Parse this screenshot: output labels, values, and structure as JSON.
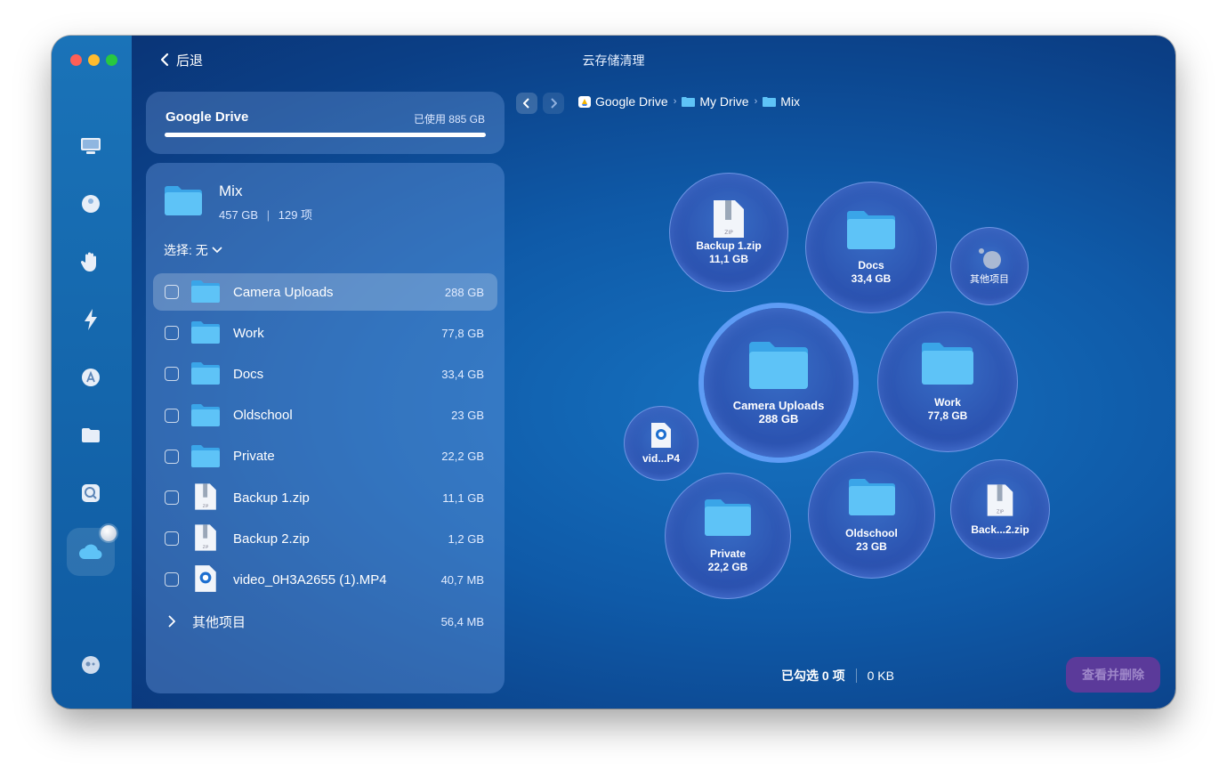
{
  "window": {
    "title": "云存储清理",
    "back_label": "后退"
  },
  "drive": {
    "name": "Google Drive",
    "used": "已使用 885 GB"
  },
  "folder": {
    "name": "Mix",
    "size": "457 GB",
    "count": "129 项",
    "separator": "|",
    "select_label": "选择: 无"
  },
  "items": [
    {
      "name": "Camera Uploads",
      "size": "288 GB",
      "type": "folder"
    },
    {
      "name": "Work",
      "size": "77,8 GB",
      "type": "folder"
    },
    {
      "name": "Docs",
      "size": "33,4 GB",
      "type": "folder"
    },
    {
      "name": "Oldschool",
      "size": "23 GB",
      "type": "folder"
    },
    {
      "name": "Private",
      "size": "22,2 GB",
      "type": "folder"
    },
    {
      "name": "Backup 1.zip",
      "size": "11,1 GB",
      "type": "zip"
    },
    {
      "name": "Backup 2.zip",
      "size": "1,2 GB",
      "type": "zip"
    },
    {
      "name": "video_0H3A2655 (1).MP4",
      "size": "40,7 MB",
      "type": "video"
    }
  ],
  "other": {
    "name": "其他项目",
    "size": "56,4 MB"
  },
  "breadcrumb": [
    "Google Drive",
    "My Drive",
    "Mix"
  ],
  "bubbles": {
    "backup1": {
      "name": "Backup 1.zip",
      "size": "11,1 GB"
    },
    "docs": {
      "name": "Docs",
      "size": "33,4 GB"
    },
    "other": {
      "name": "其他项目"
    },
    "camera": {
      "name": "Camera Uploads",
      "size": "288 GB"
    },
    "work": {
      "name": "Work",
      "size": "77,8 GB"
    },
    "video": {
      "name": "vid...P4"
    },
    "private": {
      "name": "Private",
      "size": "22,2 GB"
    },
    "oldschool": {
      "name": "Oldschool",
      "size": "23 GB"
    },
    "backup2": {
      "name": "Back...2.zip"
    }
  },
  "footer": {
    "selected": "已勾选 0 项",
    "total": "0 KB",
    "delete_label": "查看并删除"
  },
  "colors": {
    "accent": "#5e9cf5",
    "delete_button": "#5b3a9a",
    "folder": "#5ec3f7"
  }
}
